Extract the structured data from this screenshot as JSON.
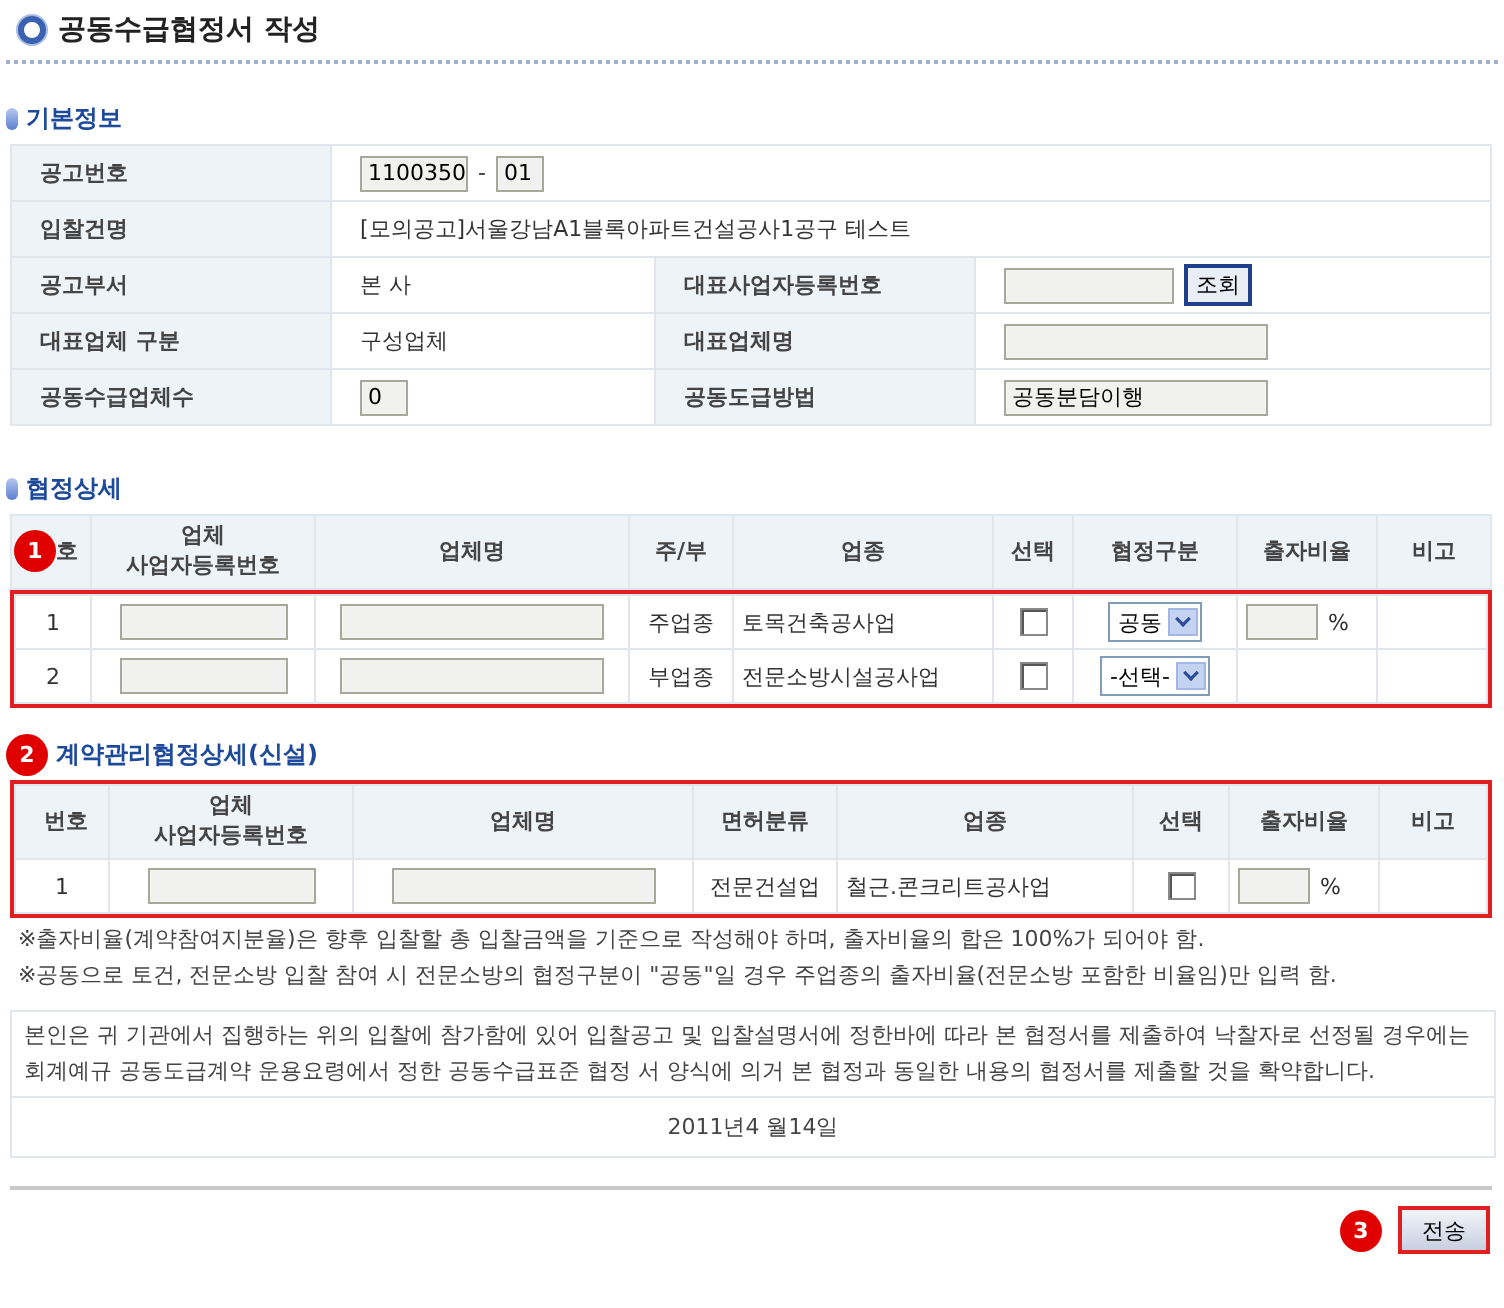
{
  "title": "공동수급협정서 작성",
  "basic_info": {
    "heading": "기본정보",
    "notice_no": {
      "label": "공고번호",
      "part1": "1100350",
      "separator": "-",
      "part2": "01"
    },
    "bid_name": {
      "label": "입찰건명",
      "value": "[모의공고]서울강남A1블록아파트건설공사1공구 테스트"
    },
    "dept": {
      "label": "공고부서",
      "value": "본 사"
    },
    "rep_reg_no": {
      "label": "대표사업자등록번호",
      "button": "조회"
    },
    "rep_type": {
      "label": "대표업체 구분",
      "value": "구성업체"
    },
    "rep_name": {
      "label": "대표업체명"
    },
    "member_count": {
      "label": "공동수급업체수",
      "value": "0"
    },
    "method": {
      "label": "공동도급방법",
      "value": "공동분담이행"
    }
  },
  "agreement": {
    "heading": "협정상세",
    "badge": "1",
    "columns": [
      "호",
      "업체\n사업자등록번호",
      "업체명",
      "주/부",
      "업종",
      "선택",
      "협정구분",
      "출자비율",
      "비고"
    ],
    "rows": [
      {
        "no": "1",
        "role": "주업종",
        "industry": "토목건축공사업",
        "checked": false,
        "division": "공동",
        "percent": "%"
      },
      {
        "no": "2",
        "role": "부업종",
        "industry": "전문소방시설공사업",
        "checked": false,
        "division": "-선택-"
      }
    ]
  },
  "contract": {
    "heading": "계약관리협정상세(신설)",
    "badge": "2",
    "columns": [
      "번호",
      "업체\n사업자등록번호",
      "업체명",
      "면허분류",
      "업종",
      "선택",
      "출자비율",
      "비고"
    ],
    "rows": [
      {
        "no": "1",
        "license": "전문건설업",
        "industry": "철근.콘크리트공사업",
        "checked": false,
        "percent": "%"
      }
    ]
  },
  "notes": [
    "※출자비율(계약참여지분율)은 향후 입찰할 총 입찰금액을 기준으로 작성해야 하며, 출자비율의 합은 100%가 되어야 함.",
    "※공동으로 토건, 전문소방 입찰 참여 시 전문소방의 협정구분이 \"공동\"일 경우 주업종의 출자비율(전문소방 포함한 비율임)만 입력 함."
  ],
  "pledge": "본인은 귀 기관에서 집행하는 위의 입찰에 참가함에 있어 입찰공고 및 입찰설명서에 정한바에 따라 본 협정서를 제출하여 낙찰자로 선정될 경우에는 회계예규 공동도급계약 운용요령에서 정한 공동수급표준 협정 서 양식에 의거 본 협정과 동일한 내용의 협정서를 제출할 것을 확약합니다.",
  "date": "2011년4 월14일",
  "submit": {
    "label": "전송",
    "badge": "3"
  }
}
